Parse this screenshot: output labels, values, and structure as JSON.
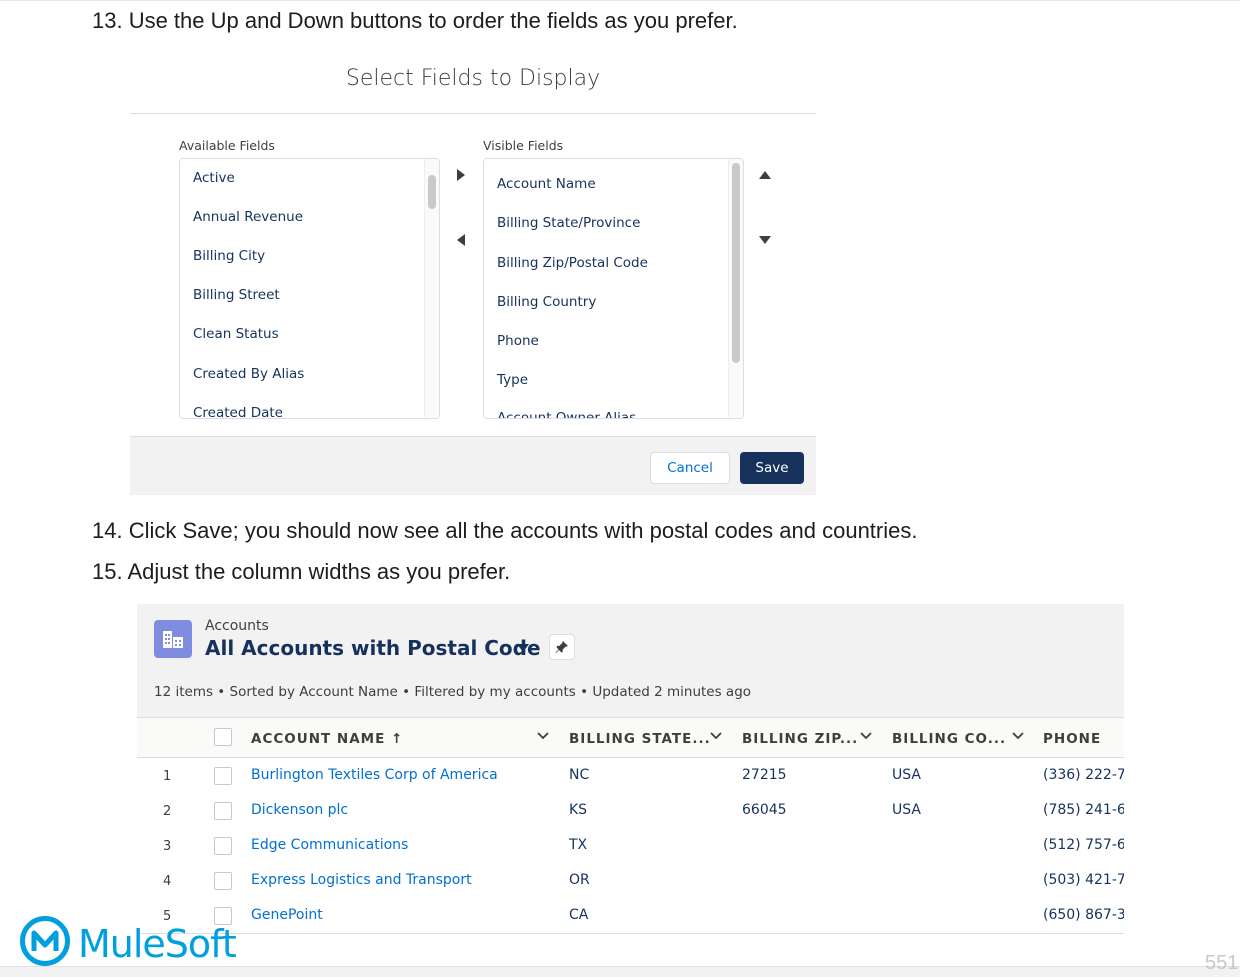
{
  "steps": {
    "s13": "13. Use the Up and Down buttons to order the fields as you prefer.",
    "s14": "14. Click Save; you should now see all the accounts with postal codes and countries.",
    "s15": "15. Adjust the column widths as you prefer."
  },
  "dialog": {
    "title": "Select Fields to Display",
    "available_label": "Available Fields",
    "visible_label": "Visible Fields",
    "available_fields": [
      "Active",
      "Annual Revenue",
      "Billing City",
      "Billing Street",
      "Clean Status",
      "Created By Alias",
      "Created Date"
    ],
    "visible_fields": [
      "Account Name",
      "Billing State/Province",
      "Billing Zip/Postal Code",
      "Billing Country",
      "Phone",
      "Type",
      "Account Owner Alias"
    ],
    "cancel_label": "Cancel",
    "save_label": "Save"
  },
  "list_view": {
    "object_label": "Accounts",
    "view_name": "All Accounts with Postal Code",
    "summary": "12 items • Sorted by Account Name • Filtered by my accounts • Updated 2 minutes ago",
    "columns": [
      "ACCOUNT NAME ↑",
      "BILLING STATE...",
      "BILLING ZIP...",
      "BILLING CO...",
      "PHONE"
    ],
    "rows": [
      {
        "num": "1",
        "name": "Burlington Textiles Corp of America",
        "state": "NC",
        "zip": "27215",
        "country": "USA",
        "phone": "(336) 222-7"
      },
      {
        "num": "2",
        "name": "Dickenson plc",
        "state": "KS",
        "zip": "66045",
        "country": "USA",
        "phone": "(785) 241-6"
      },
      {
        "num": "3",
        "name": "Edge Communications",
        "state": "TX",
        "zip": "",
        "country": "",
        "phone": "(512) 757-6"
      },
      {
        "num": "4",
        "name": "Express Logistics and Transport",
        "state": "OR",
        "zip": "",
        "country": "",
        "phone": "(503) 421-7"
      },
      {
        "num": "5",
        "name": "GenePoint",
        "state": "CA",
        "zip": "",
        "country": "",
        "phone": "(650) 867-3"
      }
    ]
  },
  "footer": {
    "logo_text": "MuleSoft",
    "page_number": "551"
  },
  "icons": [
    "right-arrow-icon",
    "left-arrow-icon",
    "up-arrow-icon",
    "down-arrow-icon",
    "accounts-icon",
    "pin-icon",
    "chevron-down-icon",
    "mulesoft-logo-icon"
  ]
}
